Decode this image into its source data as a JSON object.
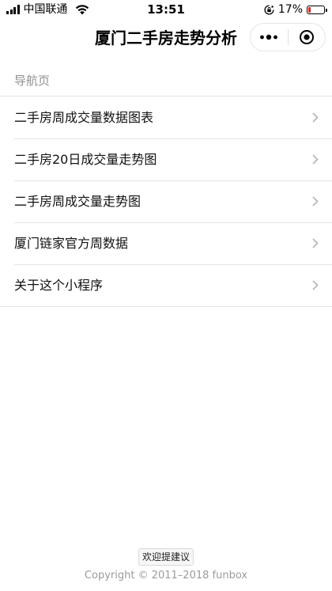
{
  "status_bar": {
    "carrier": "中国联通",
    "time": "13:51",
    "battery_percent": "17%",
    "battery_level": 0.17,
    "battery_color": "#e4261c",
    "icons": [
      "signal-icon",
      "wifi-icon",
      "orientation-lock-icon",
      "battery-icon"
    ]
  },
  "nav": {
    "title": "厦门二手房走势分析",
    "more_icon": "more-dots-icon",
    "close_icon": "circle-close-icon"
  },
  "section": {
    "title": "导航页"
  },
  "menu": {
    "items": [
      {
        "label": "二手房周成交量数据图表"
      },
      {
        "label": "二手房20日成交量走势图"
      },
      {
        "label": "二手房周成交量走势图"
      },
      {
        "label": "厦门链家官方周数据"
      },
      {
        "label": "关于这个小程序"
      }
    ],
    "chevron_icon": "chevron-right-icon"
  },
  "footer": {
    "feedback_label": "欢迎提建议",
    "copyright": "Copyright © 2011–2018 funbox"
  }
}
